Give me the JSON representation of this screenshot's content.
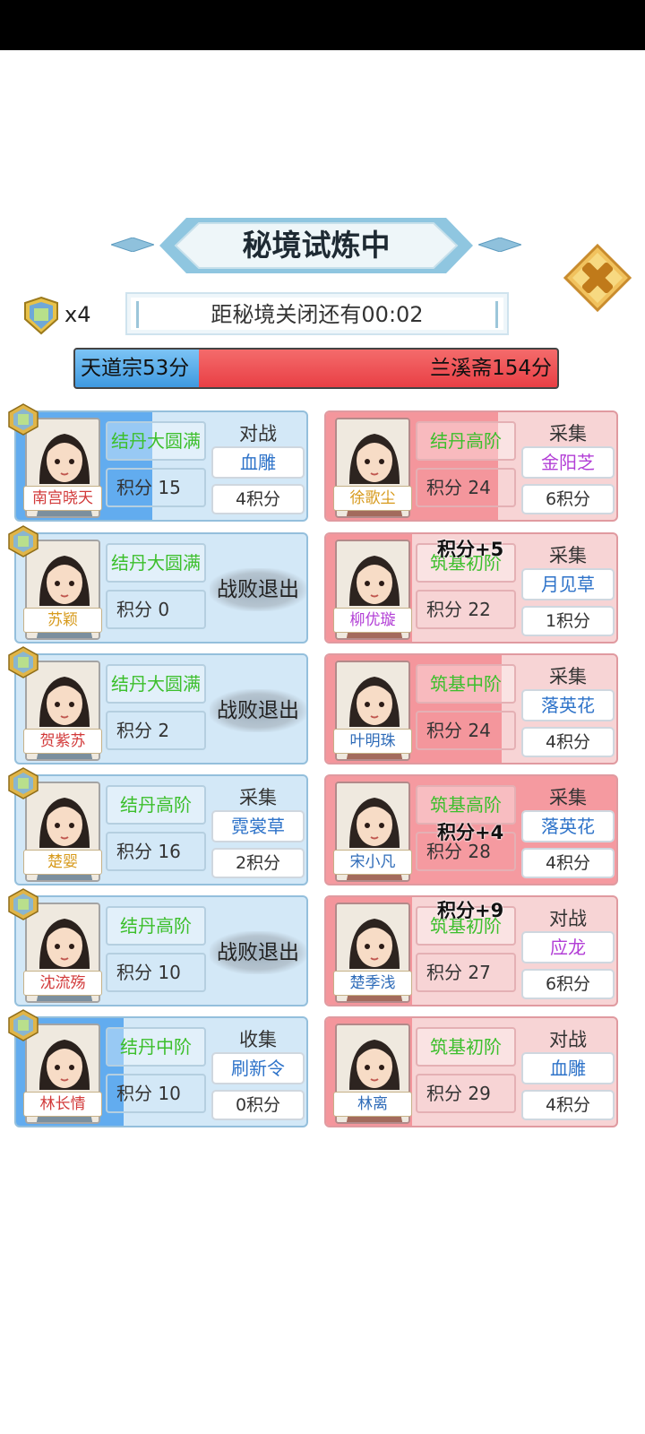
{
  "header": {
    "title": "秘境试炼中",
    "token_count": "x4",
    "timer_text": "距秘境关闭还有00:02"
  },
  "scoreboard": {
    "left_text": "天道宗53分",
    "right_text": "兰溪斋154分",
    "left_points": 53,
    "right_points": 154
  },
  "colors": {
    "left_team": "#3f9ae0",
    "right_team": "#e93f45",
    "realm_text": "#3cbf2c",
    "target_blue": "#2e73c9",
    "target_purple": "#b23ed6"
  },
  "left_team": [
    {
      "name": "南宫晓天",
      "realm": "结丹大圆满",
      "points": "积分 15",
      "action": "对战",
      "target": "血雕",
      "reward": "4积分",
      "defeated": false
    },
    {
      "name": "苏颖",
      "realm": "结丹大圆满",
      "points": "积分 0",
      "defeated": true,
      "defeated_text": "战败退出"
    },
    {
      "name": "贺紫苏",
      "realm": "结丹大圆满",
      "points": "积分 2",
      "defeated": true,
      "defeated_text": "战败退出"
    },
    {
      "name": "楚婴",
      "realm": "结丹高阶",
      "points": "积分 16",
      "action": "采集",
      "target": "霓裳草",
      "reward": "2积分",
      "defeated": false
    },
    {
      "name": "沈流殇",
      "realm": "结丹高阶",
      "points": "积分 10",
      "defeated": true,
      "defeated_text": "战败退出"
    },
    {
      "name": "林长情",
      "realm": "结丹中阶",
      "points": "积分 10",
      "action": "收集",
      "target": "刷新令",
      "reward": "0积分",
      "defeated": false
    }
  ],
  "right_team": [
    {
      "name": "徐歌尘",
      "realm": "结丹高阶",
      "points": "积分 24",
      "action": "采集",
      "target": "金阳芝",
      "reward": "6积分"
    },
    {
      "name": "柳优璇",
      "realm": "筑基初阶",
      "points": "积分 22",
      "action": "采集",
      "target": "月见草",
      "reward": "1积分"
    },
    {
      "name": "叶明珠",
      "realm": "筑基中阶",
      "points": "积分 24",
      "action": "采集",
      "target": "落英花",
      "reward": "4积分"
    },
    {
      "name": "宋小凡",
      "realm": "筑基高阶",
      "points": "积分 28",
      "action": "采集",
      "target": "落英花",
      "reward": "4积分"
    },
    {
      "name": "楚季浅",
      "realm": "筑基初阶",
      "points": "积分 27",
      "action": "对战",
      "target": "应龙",
      "reward": "6积分"
    },
    {
      "name": "林离",
      "realm": "筑基初阶",
      "points": "积分 29",
      "action": "对战",
      "target": "血雕",
      "reward": "4积分"
    }
  ],
  "floating": [
    "积分+5",
    "积分+4",
    "积分+9"
  ]
}
